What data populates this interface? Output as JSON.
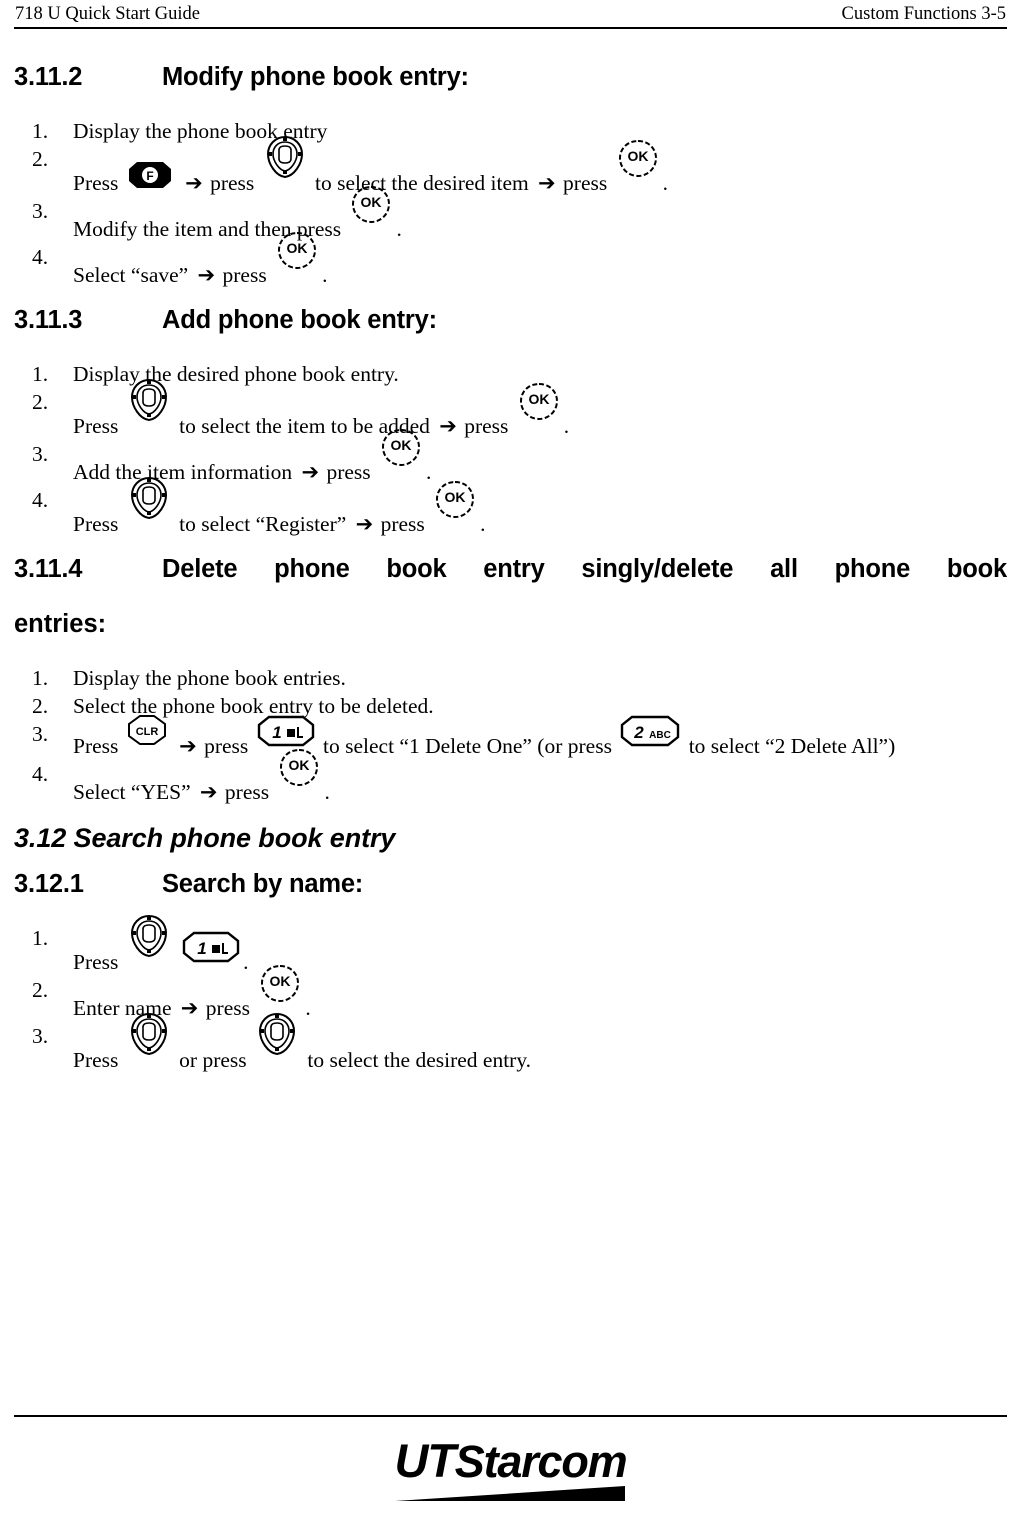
{
  "header": {
    "left": "718 U Quick Start Guide",
    "right": "Custom Functions 3-5"
  },
  "sections": [
    {
      "number": "3.11.2",
      "title": "Modify phone book entry:",
      "steps": [
        {
          "marker": "1.",
          "parts": [
            {
              "t": "text",
              "v": "Display the phone book entry"
            }
          ]
        },
        {
          "marker": "2.",
          "parts": [
            {
              "t": "text",
              "v": "Press"
            },
            {
              "t": "key",
              "v": "f-key"
            },
            {
              "t": "arrow",
              "v": "➔"
            },
            {
              "t": "text",
              "v": "press"
            },
            {
              "t": "key",
              "v": "nav-key"
            },
            {
              "t": "text",
              "v": "to select the desired item"
            },
            {
              "t": "arrow",
              "v": "➔"
            },
            {
              "t": "text",
              "v": "press"
            },
            {
              "t": "key",
              "v": "ok-key"
            },
            {
              "t": "text",
              "v": "."
            }
          ]
        },
        {
          "marker": "3.",
          "parts": [
            {
              "t": "text",
              "v": "Modify the item and then press"
            },
            {
              "t": "key",
              "v": "ok-key"
            },
            {
              "t": "text",
              "v": "."
            }
          ]
        },
        {
          "marker": "4.",
          "parts": [
            {
              "t": "text",
              "v": "Select “save”"
            },
            {
              "t": "arrow",
              "v": "➔"
            },
            {
              "t": "text",
              "v": "press"
            },
            {
              "t": "key",
              "v": "ok-key"
            },
            {
              "t": "text",
              "v": "."
            }
          ]
        }
      ]
    },
    {
      "number": "3.11.3",
      "title": "Add phone book entry:",
      "steps": [
        {
          "marker": "1.",
          "parts": [
            {
              "t": "text",
              "v": "Display the desired phone book entry."
            }
          ]
        },
        {
          "marker": "2.",
          "parts": [
            {
              "t": "text",
              "v": "Press"
            },
            {
              "t": "key",
              "v": "nav-key"
            },
            {
              "t": "text",
              "v": "to select the item to be added"
            },
            {
              "t": "arrow",
              "v": "➔"
            },
            {
              "t": "text",
              "v": "press"
            },
            {
              "t": "key",
              "v": "ok-key"
            },
            {
              "t": "text",
              "v": "."
            }
          ]
        },
        {
          "marker": "3.",
          "parts": [
            {
              "t": "text",
              "v": "Add the item information"
            },
            {
              "t": "arrow",
              "v": "➔"
            },
            {
              "t": "text",
              "v": "press"
            },
            {
              "t": "key",
              "v": "ok-key"
            },
            {
              "t": "text",
              "v": "."
            }
          ]
        },
        {
          "marker": "4.",
          "parts": [
            {
              "t": "text",
              "v": "Press"
            },
            {
              "t": "key",
              "v": "nav-key"
            },
            {
              "t": "text",
              "v": "to select “Register”"
            },
            {
              "t": "arrow",
              "v": "➔"
            },
            {
              "t": "text",
              "v": "press"
            },
            {
              "t": "key",
              "v": "ok-key"
            },
            {
              "t": "text",
              "v": "."
            }
          ]
        }
      ]
    },
    {
      "number": "3.11.4",
      "title": "Delete phone book entry singly/delete all phone book",
      "title_cont": "entries:",
      "justified": true,
      "steps": [
        {
          "marker": "1.",
          "parts": [
            {
              "t": "text",
              "v": "Display the phone book entries."
            }
          ]
        },
        {
          "marker": "2.",
          "parts": [
            {
              "t": "text",
              "v": "Select the phone book entry to be deleted."
            }
          ]
        },
        {
          "marker": "3.",
          "parts": [
            {
              "t": "text",
              "v": "Press"
            },
            {
              "t": "key",
              "v": "clr-key"
            },
            {
              "t": "arrow",
              "v": "➔"
            },
            {
              "t": "text",
              "v": "press"
            },
            {
              "t": "key",
              "v": "one-key"
            },
            {
              "t": "text",
              "v": "to select “1 Delete One” (or press"
            },
            {
              "t": "key",
              "v": "two-key"
            },
            {
              "t": "text",
              "v": "to select “2 Delete All”)"
            }
          ]
        },
        {
          "marker": "4.",
          "parts": [
            {
              "t": "text",
              "v": "Select “YES”"
            },
            {
              "t": "arrow",
              "v": "➔"
            },
            {
              "t": "text",
              "v": "press"
            },
            {
              "t": "key",
              "v": "ok-key"
            },
            {
              "t": "text",
              "v": "."
            }
          ]
        }
      ]
    }
  ],
  "section_312": {
    "heading": "3.12 Search phone book entry",
    "number": "3.12.1",
    "title": "Search by name:",
    "steps": [
      {
        "marker": "1.",
        "parts": [
          {
            "t": "text",
            "v": "Press"
          },
          {
            "t": "key",
            "v": "nav-key"
          },
          {
            "t": "key",
            "v": "one-key"
          },
          {
            "t": "text",
            "v": "."
          }
        ]
      },
      {
        "marker": "2.",
        "parts": [
          {
            "t": "text",
            "v": "Enter name"
          },
          {
            "t": "arrow",
            "v": "➔"
          },
          {
            "t": "text",
            "v": "press"
          },
          {
            "t": "key",
            "v": "ok-key"
          },
          {
            "t": "text",
            "v": "."
          }
        ]
      },
      {
        "marker": "3.",
        "parts": [
          {
            "t": "text",
            "v": "Press"
          },
          {
            "t": "key",
            "v": "nav-key"
          },
          {
            "t": "text",
            "v": "or press"
          },
          {
            "t": "key",
            "v": "nav-key"
          },
          {
            "t": "text",
            "v": "to select the desired entry."
          }
        ]
      }
    ]
  },
  "keys": {
    "f-key": {
      "label": "F",
      "name": "f-key-icon"
    },
    "ok-key": {
      "label": "OK",
      "name": "ok-key-icon"
    },
    "nav-key": {
      "label": "",
      "name": "navigation-key-icon"
    },
    "clr-key": {
      "label": "CLR",
      "name": "clr-key-icon"
    },
    "one-key": {
      "label": "1",
      "name": "number-1-key-icon"
    },
    "two-key": {
      "label": "2",
      "sub": "ABC",
      "name": "number-2-key-icon"
    }
  },
  "footer": {
    "logo_ut": "UT",
    "logo_starcom": "Starcom"
  },
  "colors": {
    "ink": "#000000",
    "paper": "#ffffff"
  }
}
